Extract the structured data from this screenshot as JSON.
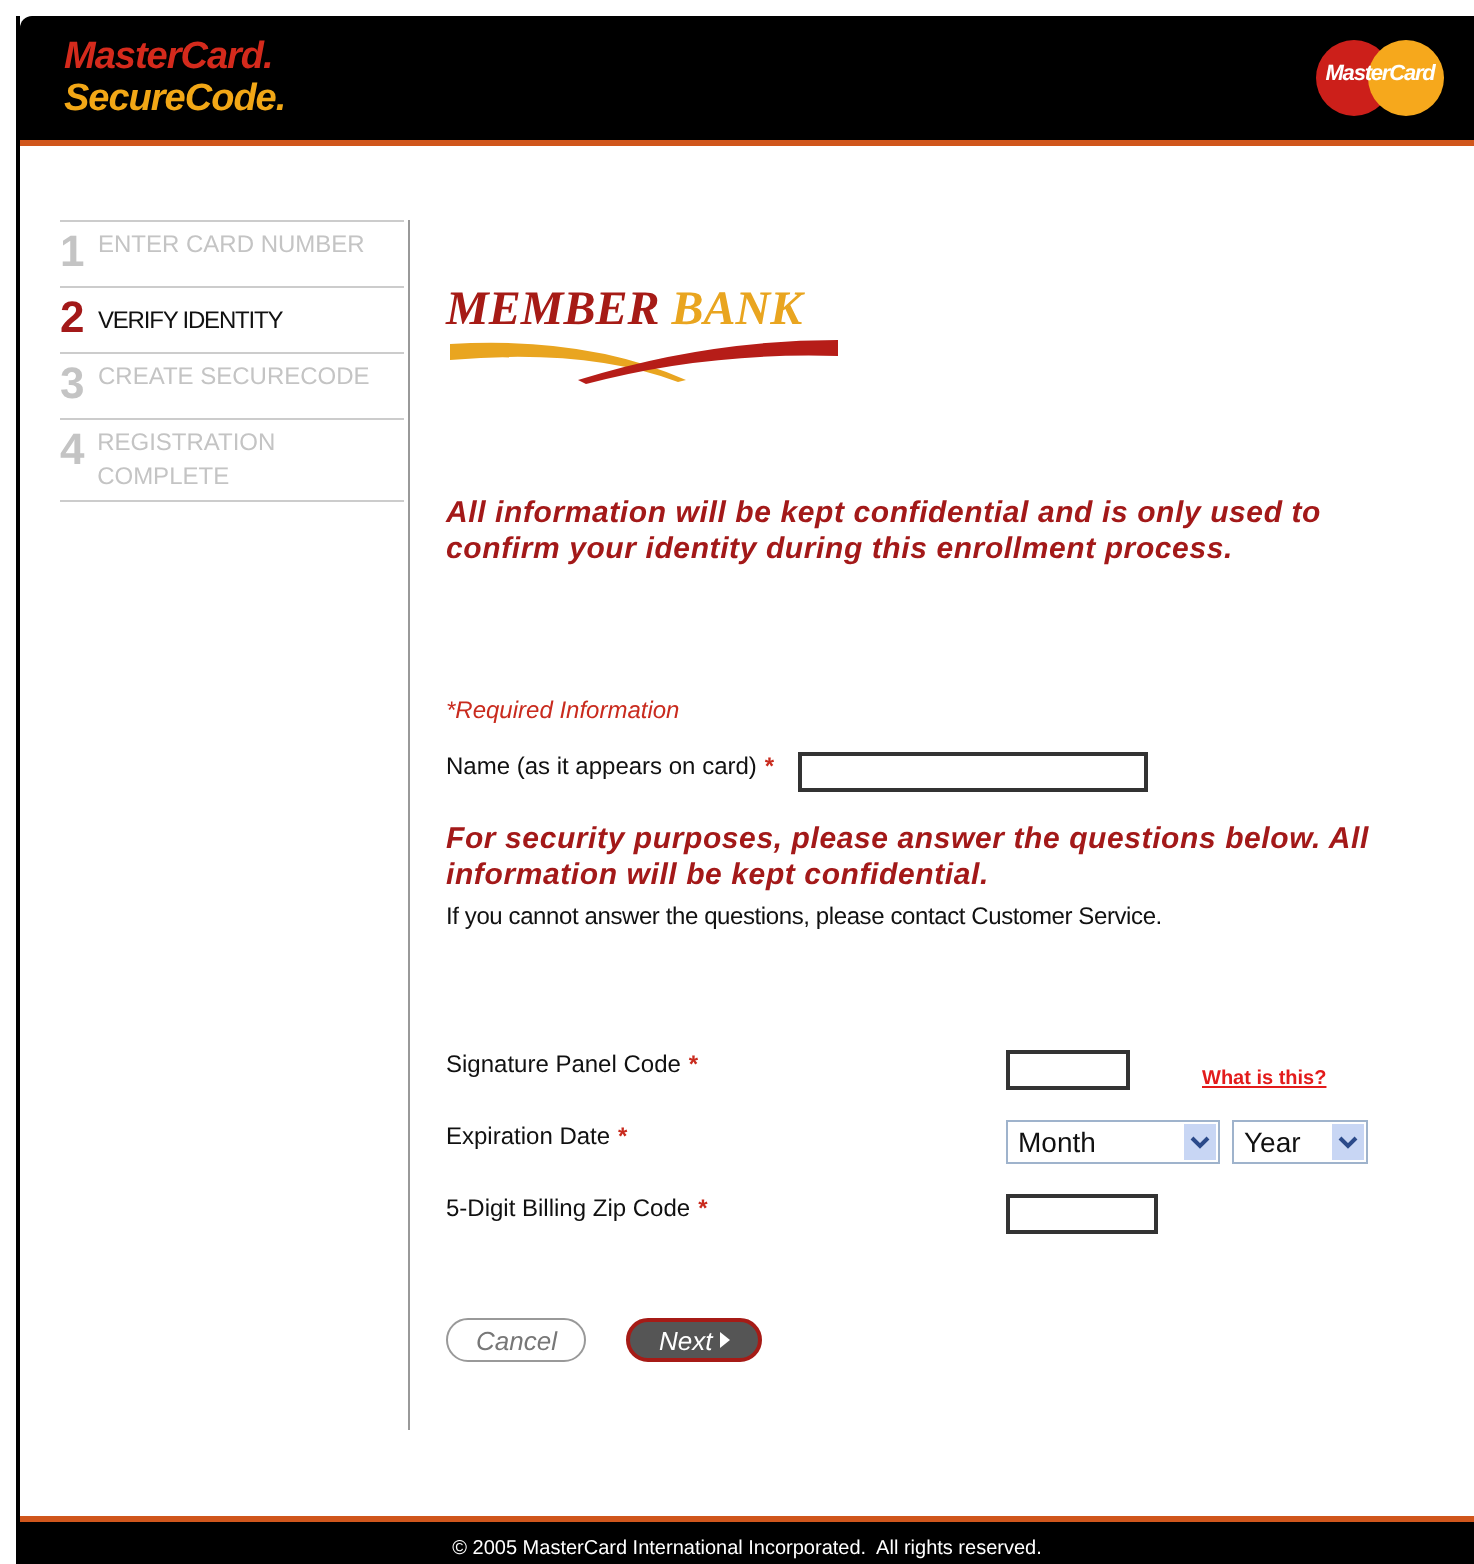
{
  "header": {
    "brand_line_1": "MasterCard.",
    "brand_line_2": "SecureCode.",
    "badge": "MasterCard"
  },
  "steps": [
    {
      "number": "1",
      "label": "ENTER CARD NUMBER",
      "selected": false
    },
    {
      "number": "2",
      "label": "VERIFY IDENTITY",
      "selected": true
    },
    {
      "number": "3",
      "label": "CREATE SECURECODE",
      "selected": false
    },
    {
      "number": "4",
      "label": "REGISTRATION COMPLETE",
      "selected": false
    }
  ],
  "bank_logo": {
    "part_1": "MEMBER",
    "part_2": "BANK"
  },
  "intro": "All information will be kept confidential and is only used to confirm your identity during this enrollment process.",
  "required_note": "*Required Information",
  "name_field": {
    "label": "Name (as it appears on card)",
    "required_mark": "*"
  },
  "security_note": "For security purposes, please answer the questions below. All information will be kept confidential.",
  "contact_note": "If you cannot answer the questions, please contact Customer Service.",
  "fields": [
    {
      "kind": "short-text",
      "label": "Signature Panel Code",
      "required_mark": "*",
      "link": "What is this?"
    },
    {
      "kind": "selects",
      "label": "Expiration Date",
      "required_mark": "*",
      "selects": [
        {
          "value": "Month"
        },
        {
          "value": "Year"
        }
      ]
    },
    {
      "kind": "text",
      "label": "5-Digit Billing Zip Code",
      "required_mark": "*"
    }
  ],
  "buttons": [
    {
      "label": "Cancel",
      "kind": "secondary"
    },
    {
      "label": "Next",
      "kind": "primary"
    }
  ],
  "footer": "© 2005 MasterCard International Incorporated.  All rights reserved."
}
